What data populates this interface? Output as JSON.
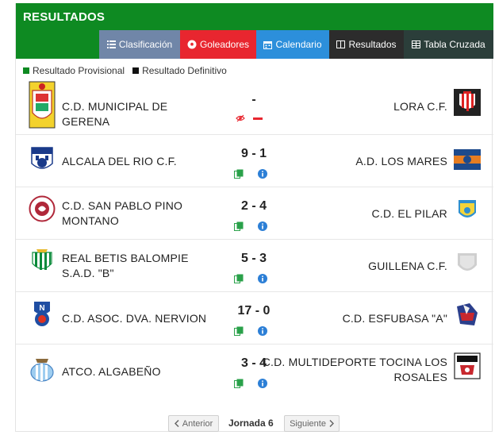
{
  "header": {
    "title": "RESULTADOS"
  },
  "tabs": [
    {
      "label": "Clasificación",
      "icon": "list-icon",
      "color": "#7086a8"
    },
    {
      "label": "Goleadores",
      "icon": "soccer-ball-icon",
      "color": "#e8262f"
    },
    {
      "label": "Calendario",
      "icon": "calendar-icon",
      "color": "#2c8fdb"
    },
    {
      "label": "Resultados",
      "icon": "window-icon",
      "color": "#2c2c2c"
    },
    {
      "label": "Tabla Cruzada",
      "icon": "grid-icon",
      "color": "#2b3e3a"
    }
  ],
  "legend": {
    "provisional": {
      "label": "Resultado Provisional",
      "color": "#0e8a22"
    },
    "definitivo": {
      "label": "Resultado Definitivo",
      "color": "#111111"
    }
  },
  "matches": [
    {
      "home": "C.D. MUNICIPAL DE GERENA",
      "score": "-",
      "away": "LORA C.F."
    },
    {
      "home": "ALCALA DEL RIO C.F.",
      "score": "9 - 1",
      "away": "A.D. LOS MARES"
    },
    {
      "home": "C.D. SAN PABLO PINO MONTANO",
      "score": "2 - 4",
      "away": "C.D. EL PILAR"
    },
    {
      "home": "REAL BETIS BALOMPIE S.A.D. \"B\"",
      "score": "5 - 3",
      "away": "GUILLENA C.F."
    },
    {
      "home": "C.D. ASOC. DVA. NERVION",
      "score": "17 - 0",
      "away": "C.D. ESFUBASA \"A\""
    },
    {
      "home": "ATCO. ALGABEÑO",
      "score": "3 - 4",
      "away": "C.D. MULTIDEPORTE TOCINA LOS ROSALES"
    }
  ],
  "pager": {
    "prev": "Anterior",
    "current": "Jornada 6",
    "next": "Siguiente"
  }
}
